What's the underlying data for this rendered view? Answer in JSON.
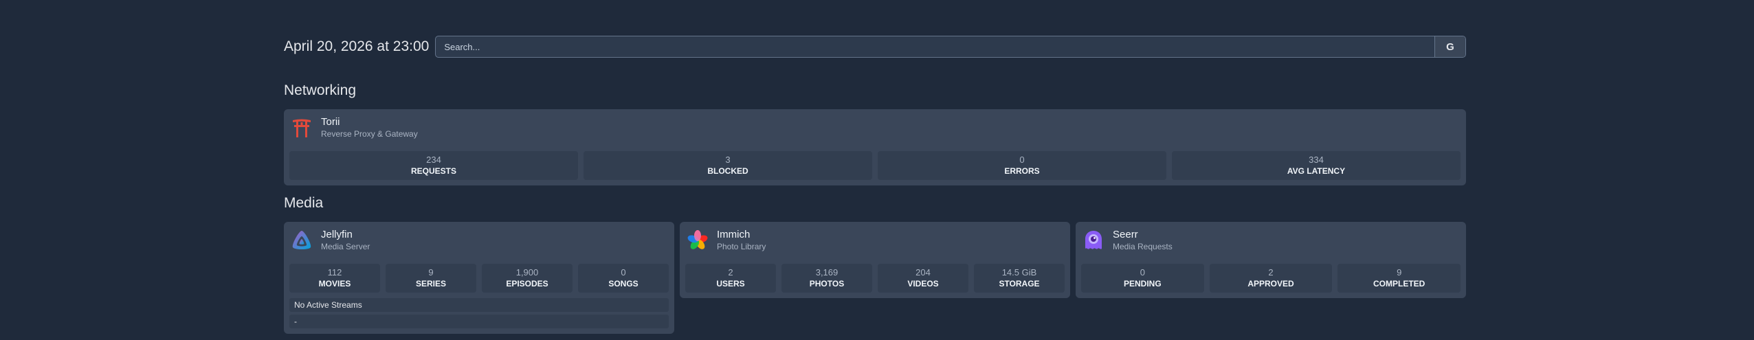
{
  "header": {
    "datetime": "April 20, 2026 at 23:00",
    "search_placeholder": "Search...",
    "search_button_label": "G"
  },
  "sections": {
    "networking": "Networking",
    "media": "Media"
  },
  "services": {
    "torii": {
      "name": "Torii",
      "description": "Reverse Proxy & Gateway",
      "icon": "torii-gate-icon",
      "stats": [
        {
          "value": "234",
          "label": "REQUESTS"
        },
        {
          "value": "3",
          "label": "BLOCKED"
        },
        {
          "value": "0",
          "label": "ERRORS"
        },
        {
          "value": "334",
          "label": "AVG LATENCY"
        }
      ]
    },
    "jellyfin": {
      "name": "Jellyfin",
      "description": "Media Server",
      "icon": "jellyfin-icon",
      "stats": [
        {
          "value": "112",
          "label": "MOVIES"
        },
        {
          "value": "9",
          "label": "SERIES"
        },
        {
          "value": "1,900",
          "label": "EPISODES"
        },
        {
          "value": "0",
          "label": "SONGS"
        }
      ],
      "streams_status": "No Active Streams",
      "streams_placeholder": "-"
    },
    "immich": {
      "name": "Immich",
      "description": "Photo Library",
      "icon": "immich-icon",
      "stats": [
        {
          "value": "2",
          "label": "USERS"
        },
        {
          "value": "3,169",
          "label": "PHOTOS"
        },
        {
          "value": "204",
          "label": "VIDEOS"
        },
        {
          "value": "14.5 GiB",
          "label": "STORAGE"
        }
      ]
    },
    "seerr": {
      "name": "Seerr",
      "description": "Media Requests",
      "icon": "seerr-icon",
      "stats": [
        {
          "value": "0",
          "label": "PENDING"
        },
        {
          "value": "2",
          "label": "APPROVED"
        },
        {
          "value": "9",
          "label": "COMPLETED"
        }
      ]
    }
  },
  "colors": {
    "background": "#1f2a3b",
    "card": "#3a4659",
    "stat_tile": "#323e50",
    "torii_red": "#e24a3b"
  }
}
